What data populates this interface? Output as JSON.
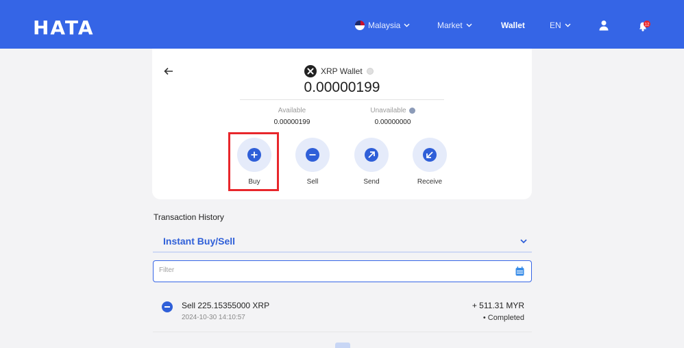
{
  "header": {
    "logo": "HATA",
    "country": "Malaysia",
    "market": "Market",
    "wallet": "Wallet",
    "language": "EN",
    "notification_count": "12"
  },
  "wallet": {
    "name": "XRP Wallet",
    "balance": "0.00000199",
    "available_label": "Available",
    "available_value": "0.00000199",
    "unavailable_label": "Unavailable",
    "unavailable_value": "0.00000000"
  },
  "actions": {
    "buy": "Buy",
    "sell": "Sell",
    "send": "Send",
    "receive": "Receive"
  },
  "history": {
    "title": "Transaction History",
    "dropdown": "Instant Buy/Sell",
    "filter_placeholder": "Filter",
    "transactions": [
      {
        "description": "Sell 225.15355000 XRP",
        "time": "2024-10-30 14:10:57",
        "amount": "+ 511.31 MYR",
        "status": "• Completed"
      }
    ]
  },
  "colors": {
    "brand": "#3565e6",
    "action_accent": "#2f5fd8",
    "highlight": "#e8262b"
  }
}
